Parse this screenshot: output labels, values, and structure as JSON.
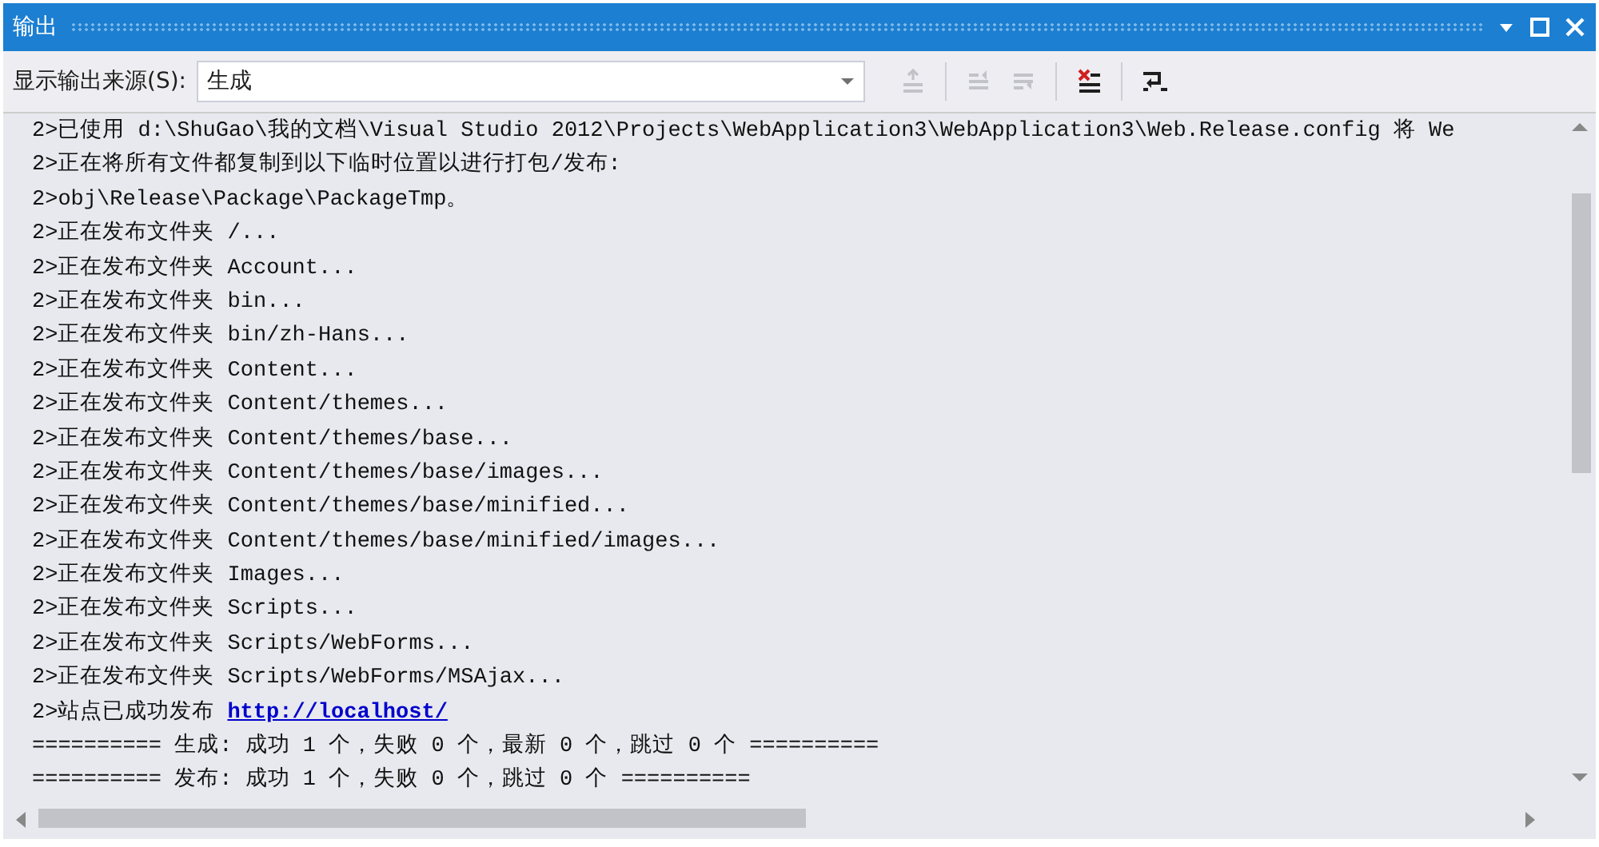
{
  "window": {
    "title": "输出"
  },
  "toolbar": {
    "source_label": "显示输出来源(S):",
    "source_value": "生成",
    "buttons": [
      {
        "kind": "goto",
        "disabled": true
      },
      {
        "kind": "prev",
        "disabled": true
      },
      {
        "kind": "next",
        "disabled": true
      },
      {
        "kind": "clear",
        "disabled": false
      },
      {
        "kind": "wrap",
        "disabled": false
      }
    ]
  },
  "output_lines": [
    {
      "text": "2>已使用 d:\\ShuGao\\我的文档\\Visual Studio 2012\\Projects\\WebApplication3\\WebApplication3\\Web.Release.config 将 We"
    },
    {
      "text": "2>正在将所有文件都复制到以下临时位置以进行打包/发布:"
    },
    {
      "text": "2>obj\\Release\\Package\\PackageTmp。"
    },
    {
      "text": "2>正在发布文件夹 /..."
    },
    {
      "text": "2>正在发布文件夹 Account..."
    },
    {
      "text": "2>正在发布文件夹 bin..."
    },
    {
      "text": "2>正在发布文件夹 bin/zh-Hans..."
    },
    {
      "text": "2>正在发布文件夹 Content..."
    },
    {
      "text": "2>正在发布文件夹 Content/themes..."
    },
    {
      "text": "2>正在发布文件夹 Content/themes/base..."
    },
    {
      "text": "2>正在发布文件夹 Content/themes/base/images..."
    },
    {
      "text": "2>正在发布文件夹 Content/themes/base/minified..."
    },
    {
      "text": "2>正在发布文件夹 Content/themes/base/minified/images..."
    },
    {
      "text": "2>正在发布文件夹 Images..."
    },
    {
      "text": "2>正在发布文件夹 Scripts..."
    },
    {
      "text": "2>正在发布文件夹 Scripts/WebForms..."
    },
    {
      "text": "2>正在发布文件夹 Scripts/WebForms/MSAjax..."
    },
    {
      "text": "2>站点已成功发布",
      "link": "http://localhost/"
    },
    {
      "text": "========== 生成: 成功 1 个，失败 0 个，最新 0 个，跳过 0 个 =========="
    },
    {
      "text": "========== 发布: 成功 1 个，失败 0 个，跳过 0 个 =========="
    }
  ]
}
